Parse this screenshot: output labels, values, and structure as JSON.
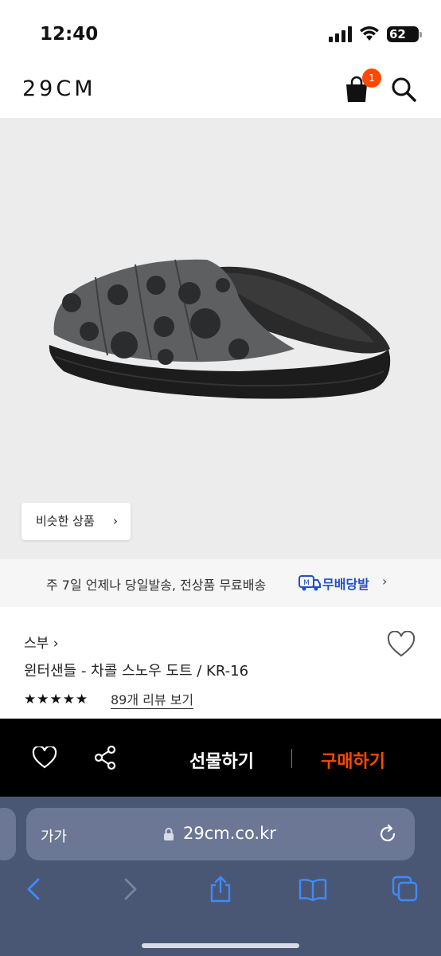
{
  "status_bar": {
    "time": "12:40",
    "battery": "62"
  },
  "header": {
    "logo": "29CM",
    "cart_count": "1"
  },
  "product_image": {
    "similar_label": "비슷한 상품"
  },
  "delivery": {
    "text": "주 7일 언제나 당일발송, 전상품 무료배송",
    "free_label": "무배당발"
  },
  "product": {
    "brand": "스부",
    "title": "윈터샌들 - 차콜 스노우 도트 / KR-16",
    "stars": "★★★★★",
    "rating": 5,
    "review_link": "89개 리뷰 보기"
  },
  "buy_bar": {
    "gift_label": "선물하기",
    "buy_label": "구매하기"
  },
  "safari": {
    "text_size": "가가",
    "url": "29cm.co.kr"
  },
  "colors": {
    "accent": "#ff4800",
    "free_delivery": "#1f4fc8",
    "safari_bg": "#4a5774"
  }
}
